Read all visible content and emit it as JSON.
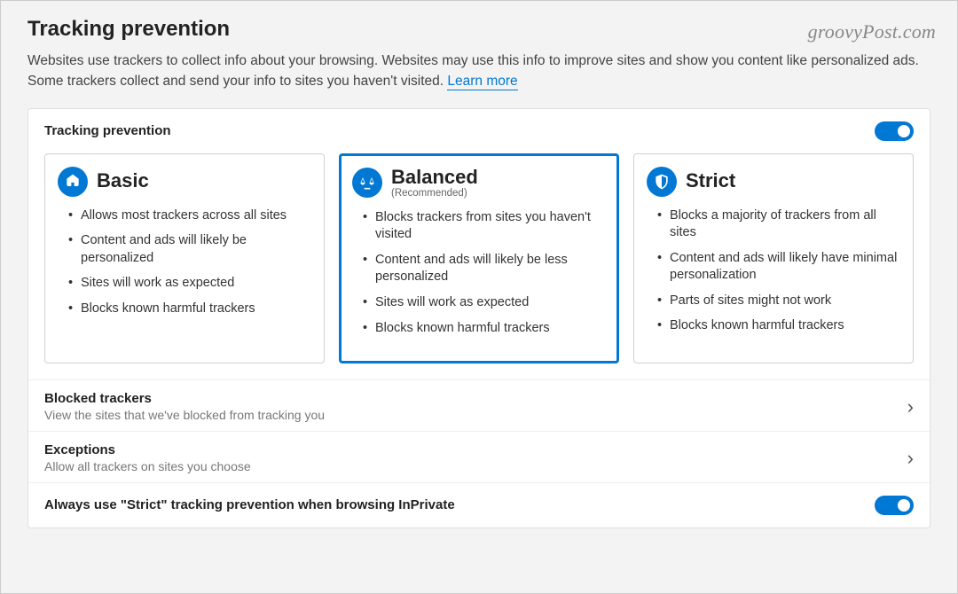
{
  "watermark": "groovyPost.com",
  "header": {
    "title": "Tracking prevention",
    "description_part1": "Websites use trackers to collect info about your browsing. Websites may use this info to improve sites and show you content like personalized ads. Some trackers collect and send your info to sites you haven't visited. ",
    "learn_more": "Learn more"
  },
  "panel": {
    "title": "Tracking prevention",
    "toggle_on": true,
    "levels": [
      {
        "id": "basic",
        "title": "Basic",
        "subtitle": "",
        "selected": false,
        "bullets": [
          "Allows most trackers across all sites",
          "Content and ads will likely be personalized",
          "Sites will work as expected",
          "Blocks known harmful trackers"
        ]
      },
      {
        "id": "balanced",
        "title": "Balanced",
        "subtitle": "(Recommended)",
        "selected": true,
        "bullets": [
          "Blocks trackers from sites you haven't visited",
          "Content and ads will likely be less personalized",
          "Sites will work as expected",
          "Blocks known harmful trackers"
        ]
      },
      {
        "id": "strict",
        "title": "Strict",
        "subtitle": "",
        "selected": false,
        "bullets": [
          "Blocks a majority of trackers from all sites",
          "Content and ads will likely have minimal personalization",
          "Parts of sites might not work",
          "Blocks known harmful trackers"
        ]
      }
    ],
    "rows": {
      "blocked": {
        "title": "Blocked trackers",
        "desc": "View the sites that we've blocked from tracking you"
      },
      "exceptions": {
        "title": "Exceptions",
        "desc": "Allow all trackers on sites you choose"
      },
      "inprivate": {
        "title": "Always use \"Strict\" tracking prevention when browsing InPrivate",
        "toggle_on": true
      }
    }
  },
  "colors": {
    "accent": "#0078d4"
  }
}
